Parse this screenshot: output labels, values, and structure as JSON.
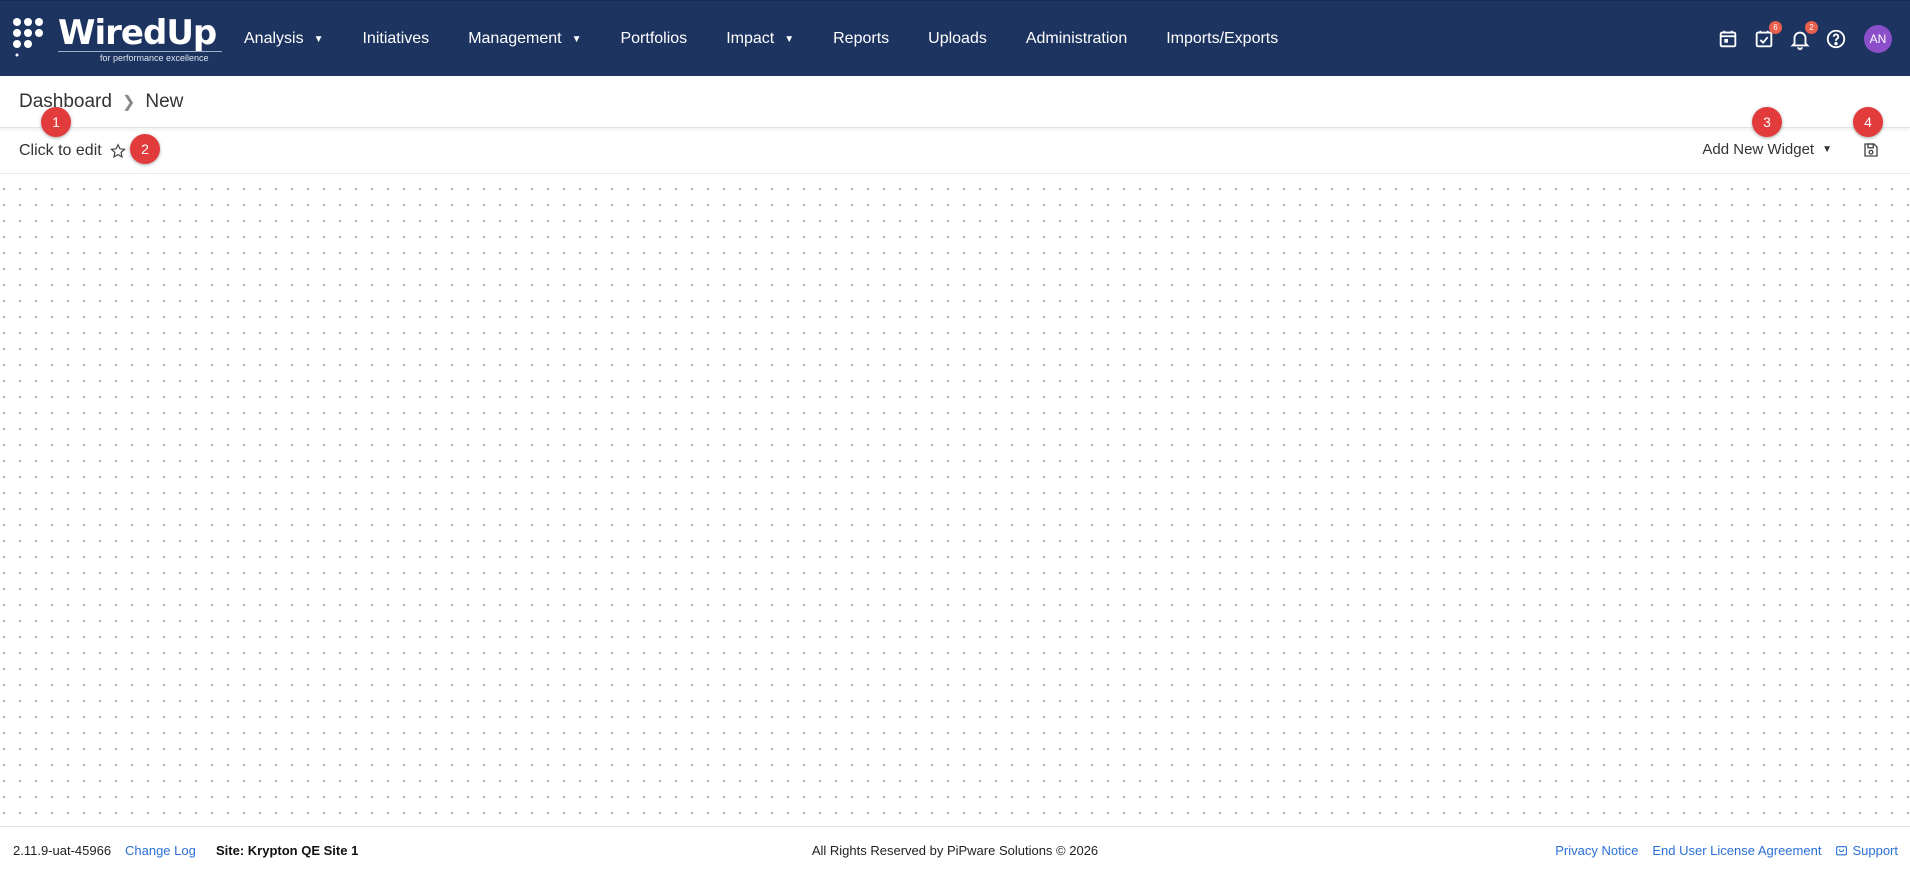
{
  "app": {
    "logo_word": "WiredUp",
    "logo_tagline": "for performance excellence"
  },
  "nav": {
    "items": [
      {
        "label": "Analysis",
        "has_menu": true
      },
      {
        "label": "Initiatives",
        "has_menu": false
      },
      {
        "label": "Management",
        "has_menu": true
      },
      {
        "label": "Portfolios",
        "has_menu": false
      },
      {
        "label": "Impact",
        "has_menu": true
      },
      {
        "label": "Reports",
        "has_menu": false
      },
      {
        "label": "Uploads",
        "has_menu": false
      },
      {
        "label": "Administration",
        "has_menu": false
      },
      {
        "label": "Imports/Exports",
        "has_menu": false
      }
    ]
  },
  "header_icons": {
    "calendar": "calendar-icon",
    "tasks": "task-check-icon",
    "tasks_badge": "6",
    "notifications": "bell-icon",
    "notifications_badge": "2",
    "help": "help-icon",
    "avatar_initials": "AN"
  },
  "breadcrumb": {
    "root": "Dashboard",
    "current": "New"
  },
  "toolbar": {
    "title": "Click to edit",
    "add_widget_label": "Add New Widget"
  },
  "markers": [
    "1",
    "2",
    "3",
    "4"
  ],
  "footer": {
    "version": "2.11.9-uat-45966",
    "change_log": "Change Log",
    "site": "Site: Krypton QE Site 1",
    "rights": "All Rights Reserved by PiPware Solutions © 2026",
    "privacy": "Privacy Notice",
    "eula": "End User License Agreement",
    "support": "Support"
  },
  "colors": {
    "topbar": "#1d3461",
    "marker": "#e23b3b",
    "link": "#2a6fd6",
    "avatar": "#8a4fc9",
    "badge": "#e8604c"
  }
}
